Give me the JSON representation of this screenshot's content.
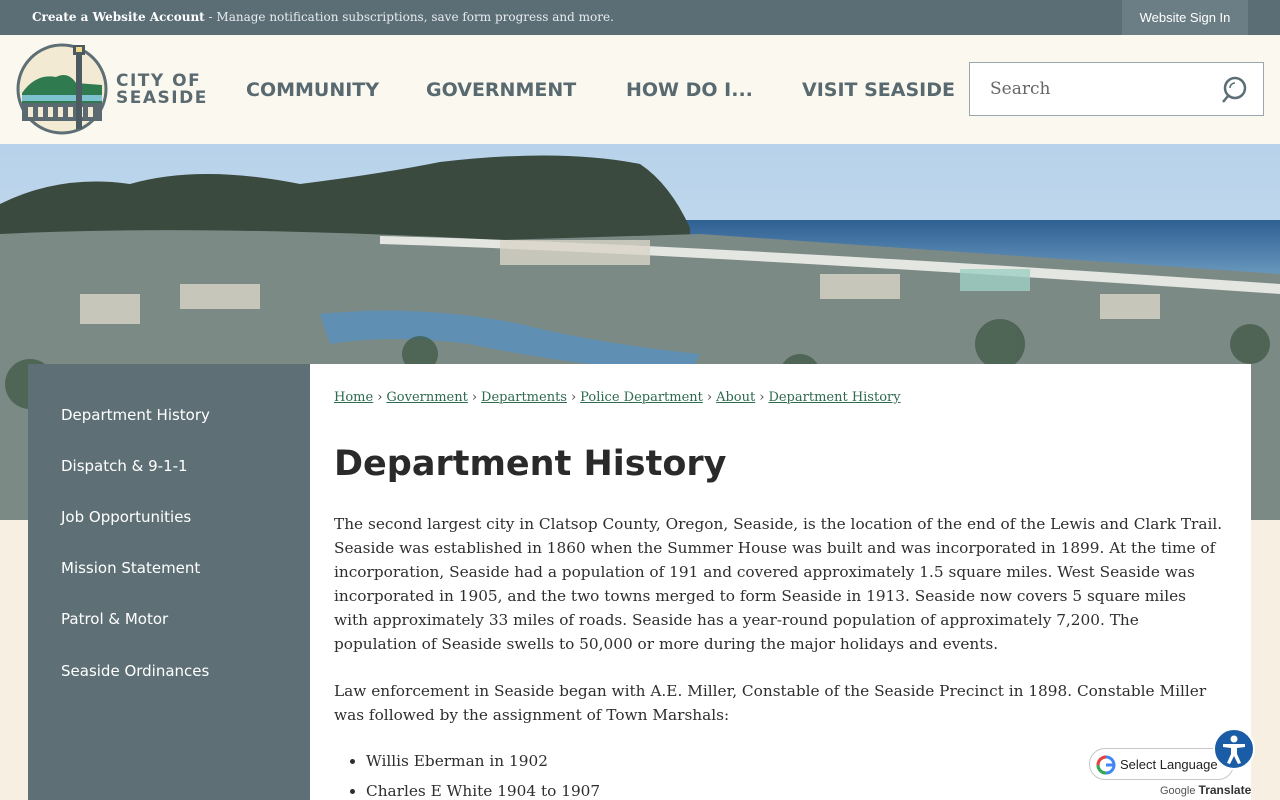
{
  "topbar": {
    "account_link": "Create a Website Account",
    "account_desc": " - Manage notification subscriptions, save form progress and more.",
    "signin": "Website Sign In"
  },
  "logo": {
    "line1": "CITY OF",
    "line2": "SEASIDE"
  },
  "nav": [
    "COMMUNITY",
    "GOVERNMENT",
    "HOW DO I...",
    "VISIT SEASIDE"
  ],
  "search": {
    "placeholder": "Search",
    "icon": "search-icon"
  },
  "sidebar": {
    "items": [
      {
        "label": "Department History"
      },
      {
        "label": "Dispatch & 9-1-1"
      },
      {
        "label": "Job Opportunities"
      },
      {
        "label": "Mission Statement"
      },
      {
        "label": "Patrol & Motor"
      },
      {
        "label": "Seaside Ordinances"
      }
    ]
  },
  "breadcrumb": [
    "Home",
    "Government",
    "Departments",
    "Police Department",
    "About",
    "Department History"
  ],
  "page": {
    "title": "Department History",
    "para1": "The second largest city in Clatsop County, Oregon, Seaside, is the location of the end of the Lewis and Clark Trail. Seaside was established in 1860 when the Summer House was built and was incorporated in 1899. At the time of incorporation, Seaside had a population of 191 and covered approximately 1.5 square miles. West Seaside was incorporated in 1905, and the two towns merged to form Seaside in 1913. Seaside now covers 5 square miles with approximately 33 miles of roads. Seaside has a year-round population of approximately 7,200. The population of Seaside swells to 50,000 or more during the major holidays and events.",
    "para2": "Law enforcement in Seaside began with A.E. Miller, Constable of the Seaside Precinct in 1898. Constable Miller was followed by the assignment of Town Marshals:",
    "marshals": [
      "Willis Eberman in 1902",
      "Charles E White 1904 to 1907"
    ]
  },
  "translate": {
    "label": "Select Language",
    "powered_by": "Google",
    "translate": "Translate"
  },
  "colors": {
    "topbar": "#5b6e76",
    "sidebar": "#5e7076",
    "link": "#2d6a4f",
    "accent": "#1a5da6"
  }
}
